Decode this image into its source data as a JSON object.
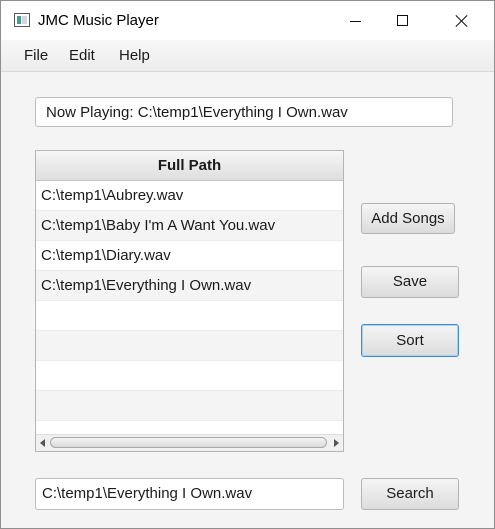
{
  "window": {
    "title": "JMC Music Player",
    "controls": {
      "minimize": "minimize-icon",
      "maximize": "maximize-icon",
      "close": "close-icon"
    }
  },
  "menu": {
    "items": [
      "File",
      "Edit",
      "Help"
    ]
  },
  "now_playing": {
    "value": "Now Playing: C:\\temp1\\Everything I Own.wav"
  },
  "table": {
    "column_header": "Full Path",
    "rows": [
      "C:\\temp1\\Aubrey.wav",
      "C:\\temp1\\Baby I'm A Want You.wav",
      "C:\\temp1\\Diary.wav",
      "C:\\temp1\\Everything I Own.wav",
      "",
      "",
      "",
      "",
      ""
    ]
  },
  "buttons": {
    "add_songs": "Add Songs",
    "save": "Save",
    "sort": "Sort",
    "search": "Search"
  },
  "search": {
    "value": "C:\\temp1\\Everything I Own.wav"
  },
  "colors": {
    "focus_border": "#3c8fd6"
  }
}
